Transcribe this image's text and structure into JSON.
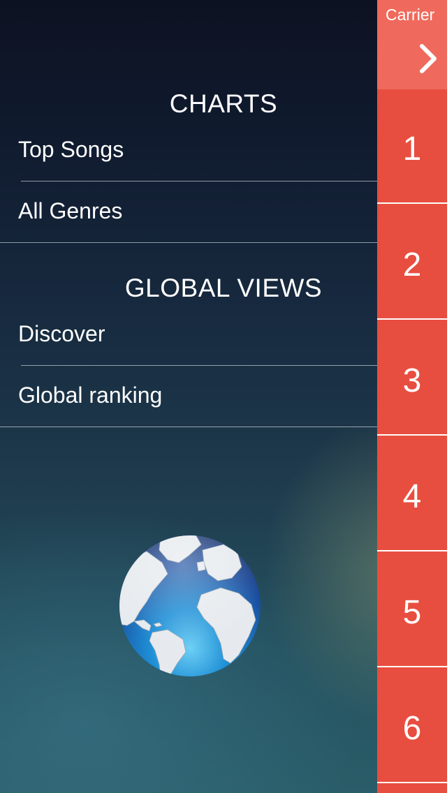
{
  "status_bar": {
    "carrier": "Carrier"
  },
  "menu": {
    "sections": [
      {
        "title": "CHARTS",
        "items": [
          "Top Songs",
          "All Genres"
        ]
      },
      {
        "title": "GLOBAL VIEWS",
        "items": [
          "Discover",
          "Global ranking"
        ]
      }
    ]
  },
  "ranks": [
    "1",
    "2",
    "3",
    "4",
    "5",
    "6"
  ],
  "colors": {
    "rank_red": "#e84e3f",
    "rank_header": "#ef6a5c",
    "menu_bg_top": "#0d1222",
    "menu_bg_bottom": "#2a5d69"
  },
  "icons": {
    "expand": "chevron-right-icon",
    "world": "globe-icon"
  }
}
